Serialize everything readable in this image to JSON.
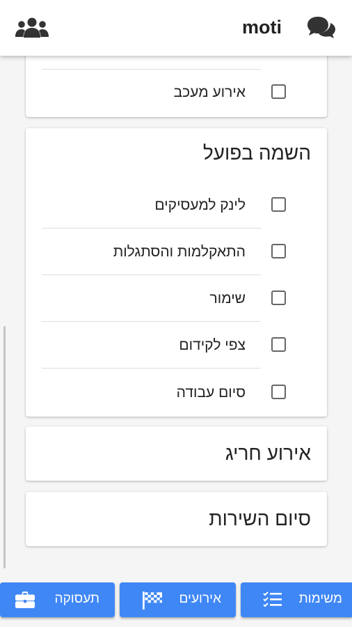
{
  "header": {
    "username": "moti",
    "left_icon": "users-icon",
    "right_icon": "chat-icon"
  },
  "cards": {
    "previous": {
      "items": [
        {
          "label": "אירוע מעכב",
          "checked": false
        }
      ]
    },
    "placement": {
      "title": "השמה בפועל",
      "items": [
        {
          "label": "לינק למעסיקים",
          "checked": false
        },
        {
          "label": "התאקלמות והסתגלות",
          "checked": false
        },
        {
          "label": "שימור",
          "checked": false
        },
        {
          "label": "צפי לקידום",
          "checked": false
        },
        {
          "label": "סיום עבודה",
          "checked": false
        }
      ]
    },
    "exceptional": {
      "title": "אירוע חריג"
    },
    "service_end": {
      "title": "סיום השירות"
    }
  },
  "bottom_nav": {
    "employment": {
      "label": "תעסוקה",
      "icon": "briefcase-icon"
    },
    "events": {
      "label": "אירועים",
      "icon": "checkered-flag-icon"
    },
    "tasks": {
      "label": "משימות",
      "icon": "tasks-list-icon"
    }
  },
  "colors": {
    "accent": "#3f87f5",
    "background": "#f5f5f5",
    "card": "#ffffff"
  }
}
